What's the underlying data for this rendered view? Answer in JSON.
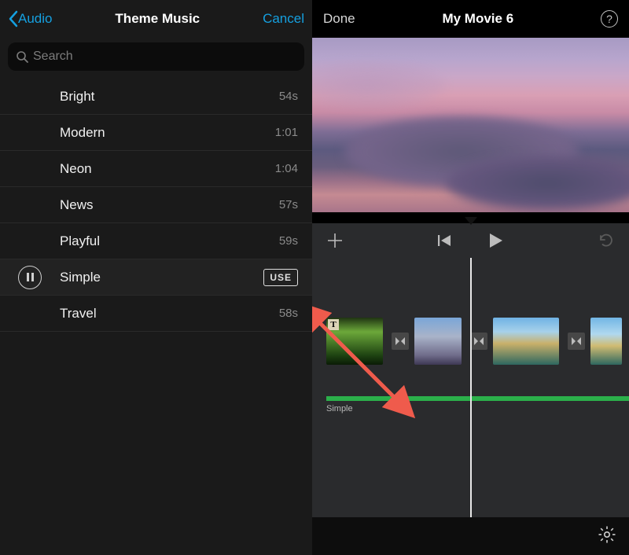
{
  "left": {
    "back_label": "Audio",
    "title": "Theme Music",
    "cancel_label": "Cancel",
    "search_placeholder": "Search",
    "tracks": [
      {
        "name": "Bright",
        "duration": "54s"
      },
      {
        "name": "Modern",
        "duration": "1:01"
      },
      {
        "name": "Neon",
        "duration": "1:04"
      },
      {
        "name": "News",
        "duration": "57s"
      },
      {
        "name": "Playful",
        "duration": "59s"
      },
      {
        "name": "Simple",
        "duration": ""
      },
      {
        "name": "Travel",
        "duration": "58s"
      }
    ],
    "selected_index": 5,
    "use_label": "USE"
  },
  "right": {
    "done_label": "Done",
    "title": "My Movie 6",
    "help_label": "?",
    "audio_track_label": "Simple",
    "clip_text_badge": "T"
  }
}
